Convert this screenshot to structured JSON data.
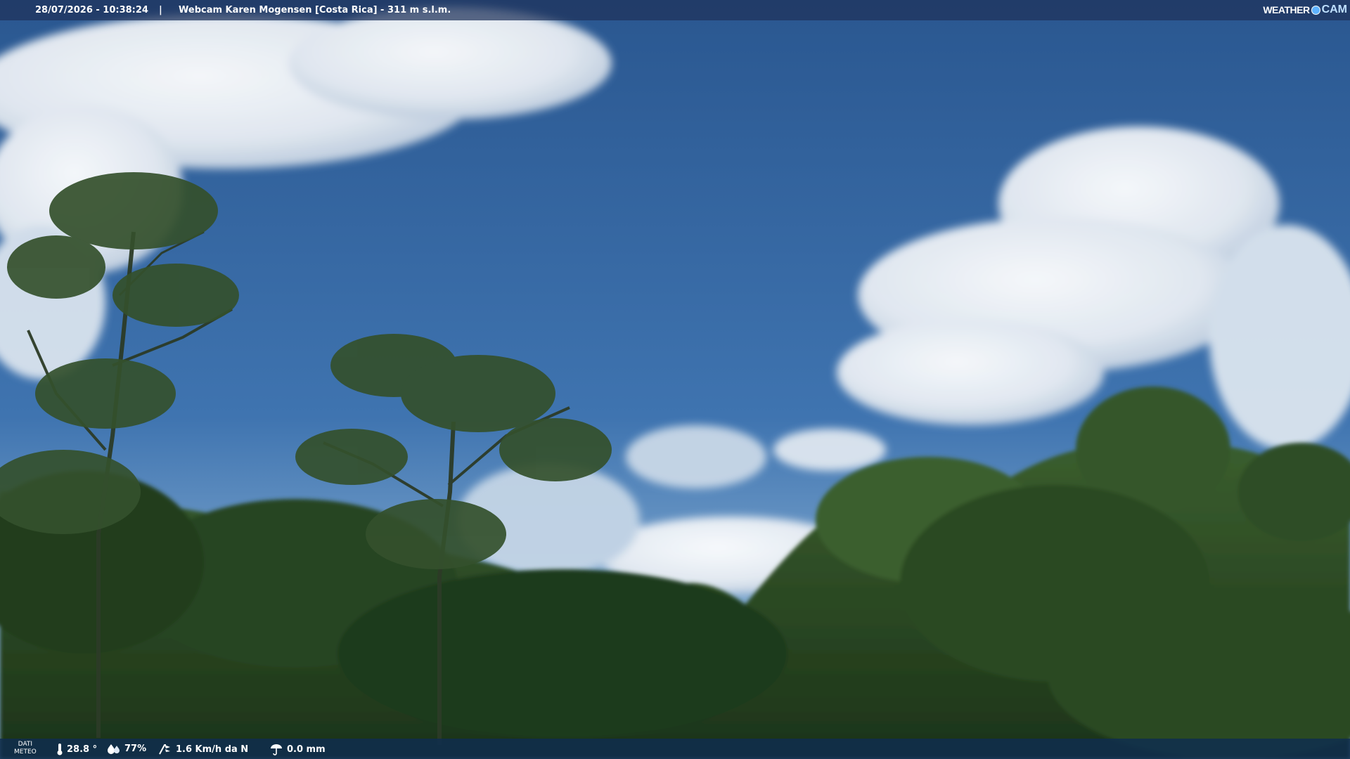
{
  "header": {
    "timestamp": "28/07/2026 - 10:38:24",
    "separator": "|",
    "title": "Webcam Karen Mogensen [Costa Rica]  - 311 m s.l.m.",
    "logo_word": "WEATHER",
    "logo_cam": "CAM"
  },
  "footer": {
    "meteo_line1": "DATI",
    "meteo_line2": "METEO",
    "temperature": "28.8 °",
    "humidity": "77%",
    "wind": "1.6 Km/h da N",
    "rain": "0.0 mm"
  },
  "icons": {
    "temperature": "thermometer-icon",
    "humidity": "humidity-drop-icon",
    "wind": "wind-icon",
    "rain": "rain-icon"
  },
  "colors": {
    "sky": "#2e5f9a",
    "bar": "#1e325a",
    "foliage": "#2b4a24"
  }
}
